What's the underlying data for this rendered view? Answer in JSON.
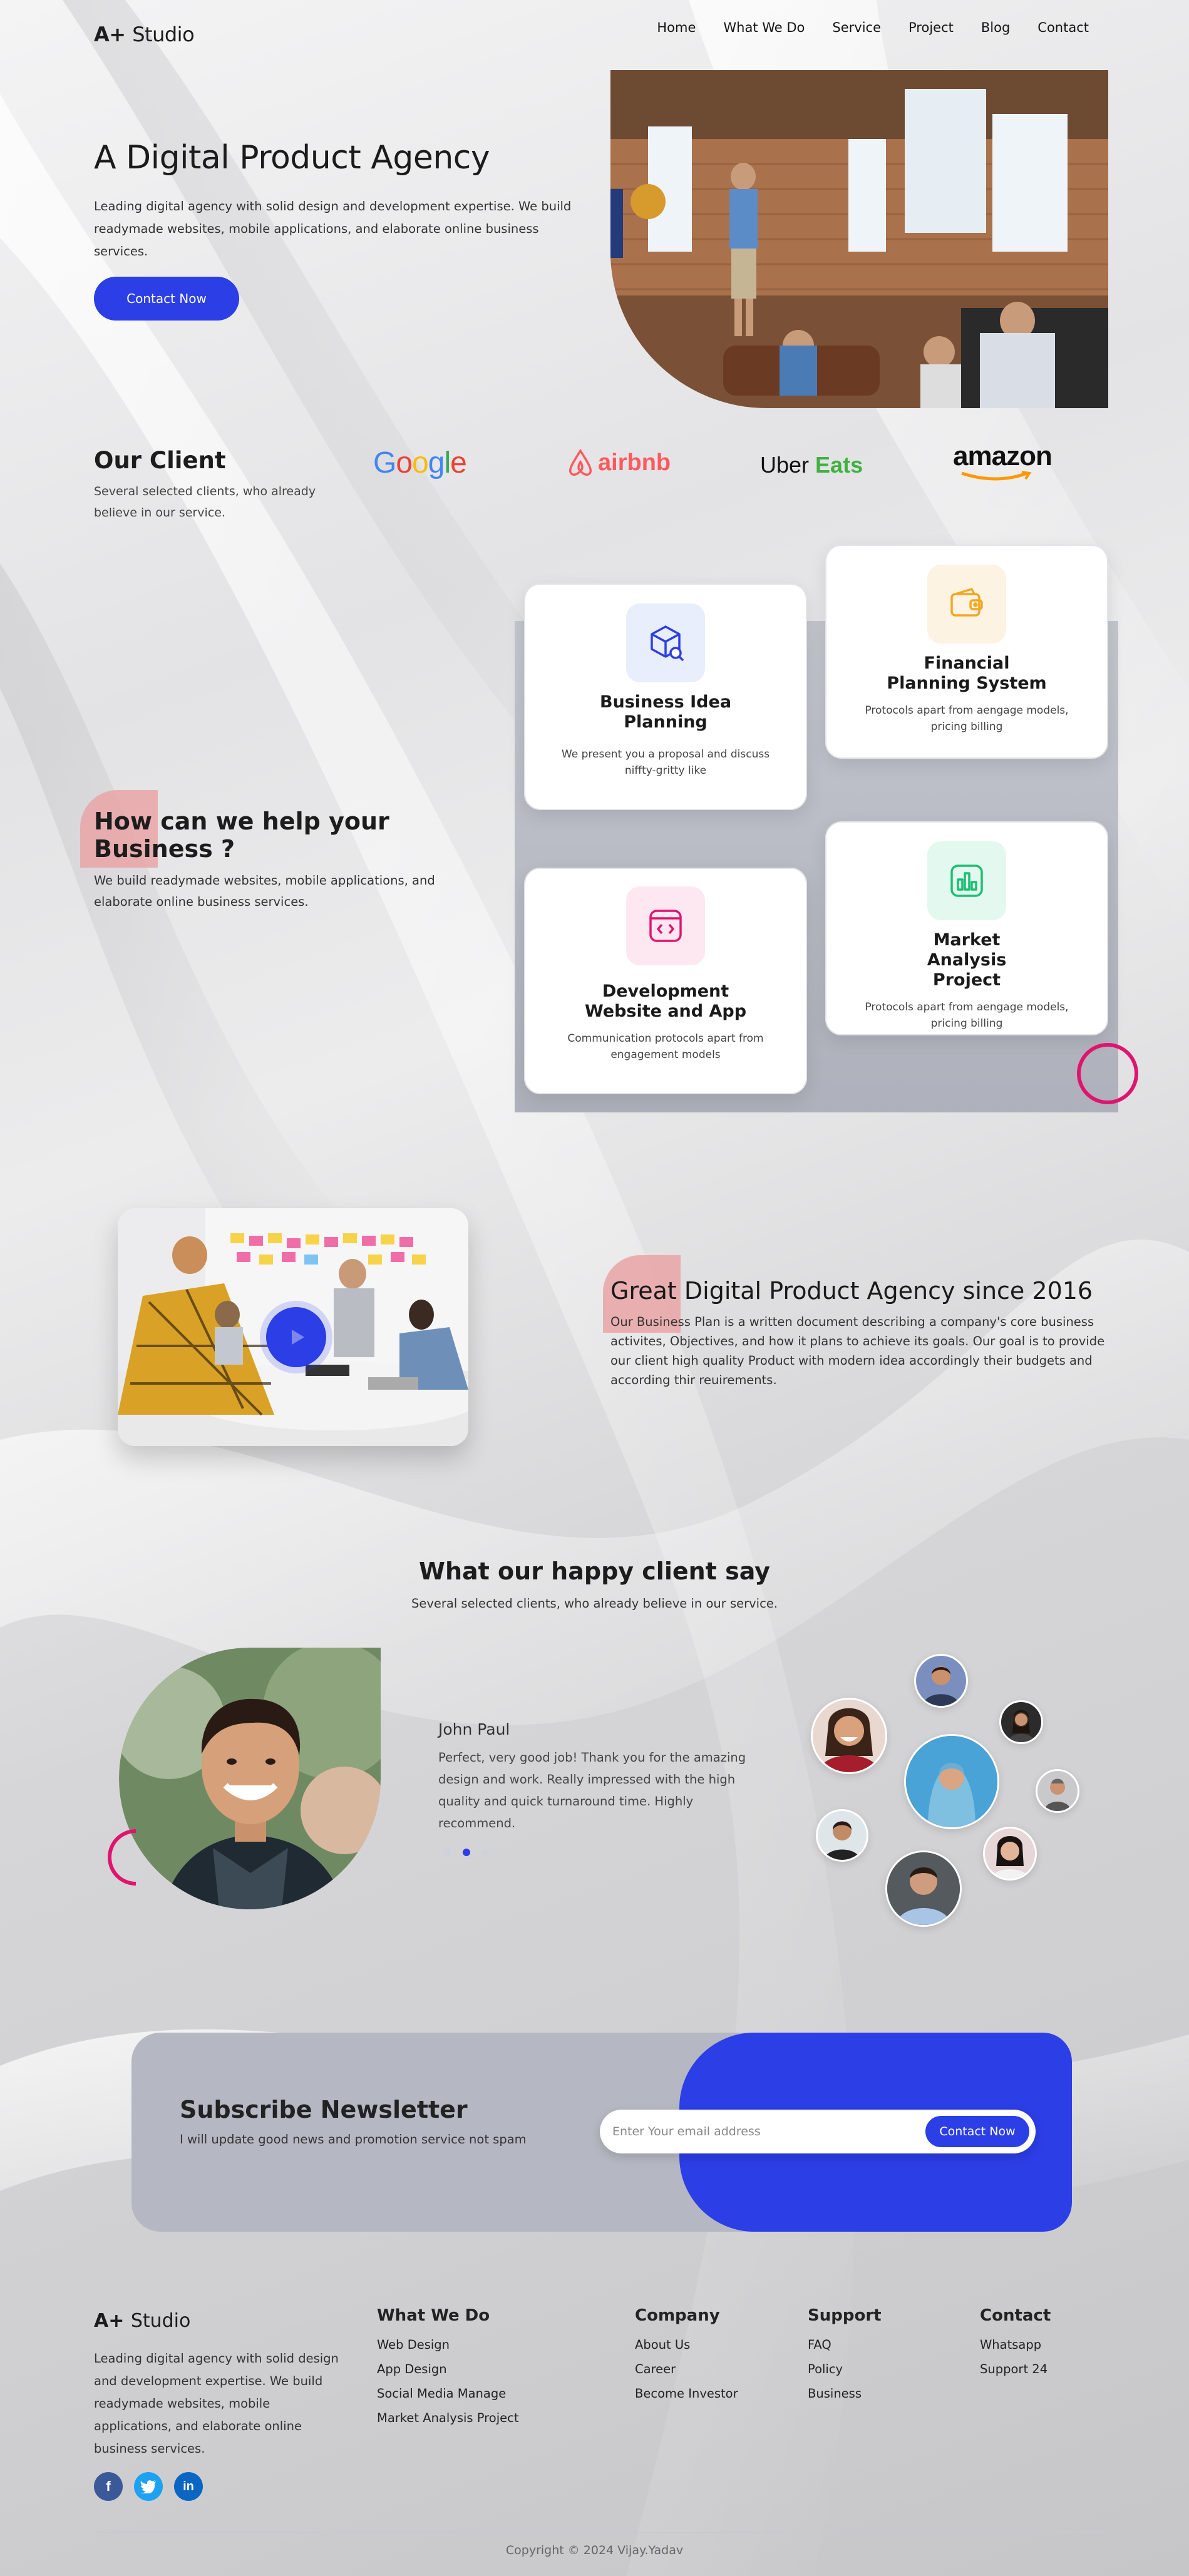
{
  "brand": {
    "logo_mark": "A+",
    "logo_name": "Studio"
  },
  "nav": {
    "items": [
      "Home",
      "What We Do",
      "Service",
      "Project",
      "Blog",
      "Contact"
    ]
  },
  "hero": {
    "title": "A Digital Product Agency",
    "text": "Leading digital agency with solid design and development expertise. We build readymade websites, mobile applications, and elaborate online business services.",
    "cta": "Contact Now"
  },
  "clients": {
    "title": "Our Client",
    "text": "Several selected clients, who already believe in our service.",
    "logos": [
      "Google",
      "airbnb",
      "Uber",
      "Eats",
      "amazon"
    ]
  },
  "help": {
    "title": "How can we help your Business ?",
    "text": "We build readymade websites, mobile applications, and elaborate online business services.",
    "cards": [
      {
        "title": "Business Idea Planning",
        "text": "We present you a proposal and discuss niffty-gritty like",
        "icon": "box-search-icon"
      },
      {
        "title": "Financial Planning System",
        "text": "Protocols apart from aengage models, pricing billing",
        "icon": "wallet-icon"
      },
      {
        "title": "Development Website and App",
        "text": "Communication protocols apart from engagement models",
        "icon": "code-window-icon"
      },
      {
        "title": "Market Analysis Project",
        "text": "Protocols apart from aengage models, pricing billing",
        "icon": "bar-chart-icon"
      }
    ]
  },
  "about": {
    "title": "Great Digital Product Agency since 2016",
    "text": "Our Business Plan is a written document describing a company's core business activites, Objectives, and how it plans to achieve its goals. Our goal is to provide our client high quality Product with modern idea accordingly their budgets and according thir reuirements."
  },
  "testimonials": {
    "title": "What our happy client say",
    "subtitle": "Several selected clients, who already believe in our service.",
    "name": "John Paul",
    "quote": "Perfect, very good job! Thank you for the amazing design and work. Really impressed with the high quality and quick turnaround time. Highly recommend."
  },
  "newsletter": {
    "title": "Subscribe Newsletter",
    "text": "I will update good news and promotion service not spam",
    "placeholder": "Enter Your email address",
    "button": "Contact Now"
  },
  "footer": {
    "logo_mark": "A+",
    "logo_name": "Studio",
    "about": "Leading digital agency with solid design and development expertise. We build readymade websites, mobile applications, and elaborate online business services.",
    "cols": [
      {
        "title": "What We Do",
        "links": [
          "Web Design",
          "App Design",
          "Social Media Manage",
          "Market Analysis Project"
        ]
      },
      {
        "title": "Company",
        "links": [
          "About Us",
          "Career",
          "Become Investor"
        ]
      },
      {
        "title": "Support",
        "links": [
          "FAQ",
          "Policy",
          "Business"
        ]
      },
      {
        "title": "Contact",
        "links": [
          "Whatsapp",
          "Support 24"
        ]
      }
    ],
    "copyright": "Copyright © 2024 Vijay.Yadav"
  },
  "colors": {
    "accent": "#2c3ee6",
    "pink": "#e0146f",
    "salmon": "#e9a4a6"
  }
}
